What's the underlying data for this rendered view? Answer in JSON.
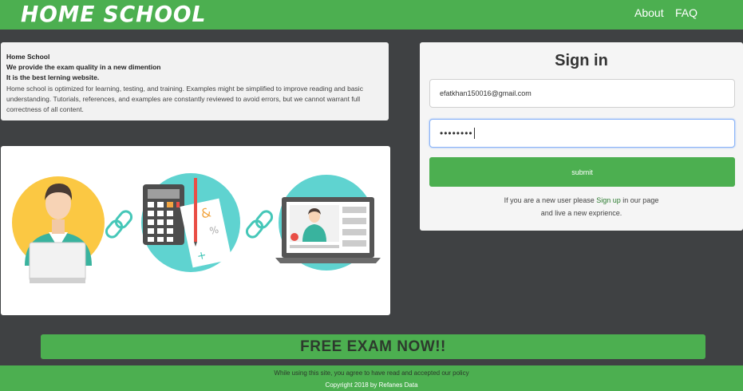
{
  "header": {
    "brand": "HOME SCHOOL",
    "nav": [
      "About",
      "FAQ"
    ]
  },
  "info": {
    "line1": "Home School",
    "line2": "We provide the exam quality in a new dimention",
    "line3": "It is the best lerning website.",
    "description": "Home school is optimized for learning, testing, and training. Examples might be simplified to improve reading and basic understanding. Tutorials, references, and examples are constantly reviewed to avoid errors, but we cannot warrant full correctness of all content."
  },
  "signin": {
    "title": "Sign in",
    "email_value": "efatkhan150016@gmail.com",
    "password_value": "••••••••",
    "submit_label": "submit",
    "signup_prefix": "If you are a new user please",
    "signup_link": "Sign up",
    "signup_suffix": "in our page",
    "signup_line2": "and live a new exprience."
  },
  "cta": {
    "label": "FREE EXAM NOW!!"
  },
  "footer": {
    "notice": "While using this site, you agree to have read and accepted our policy",
    "copyright": "Copyright 2018 by Refanes Data"
  },
  "colors": {
    "primary_green": "#4caf50",
    "background": "#3f4143",
    "illustration_teal": "#5fd3d0",
    "illustration_yellow": "#fbc843"
  }
}
